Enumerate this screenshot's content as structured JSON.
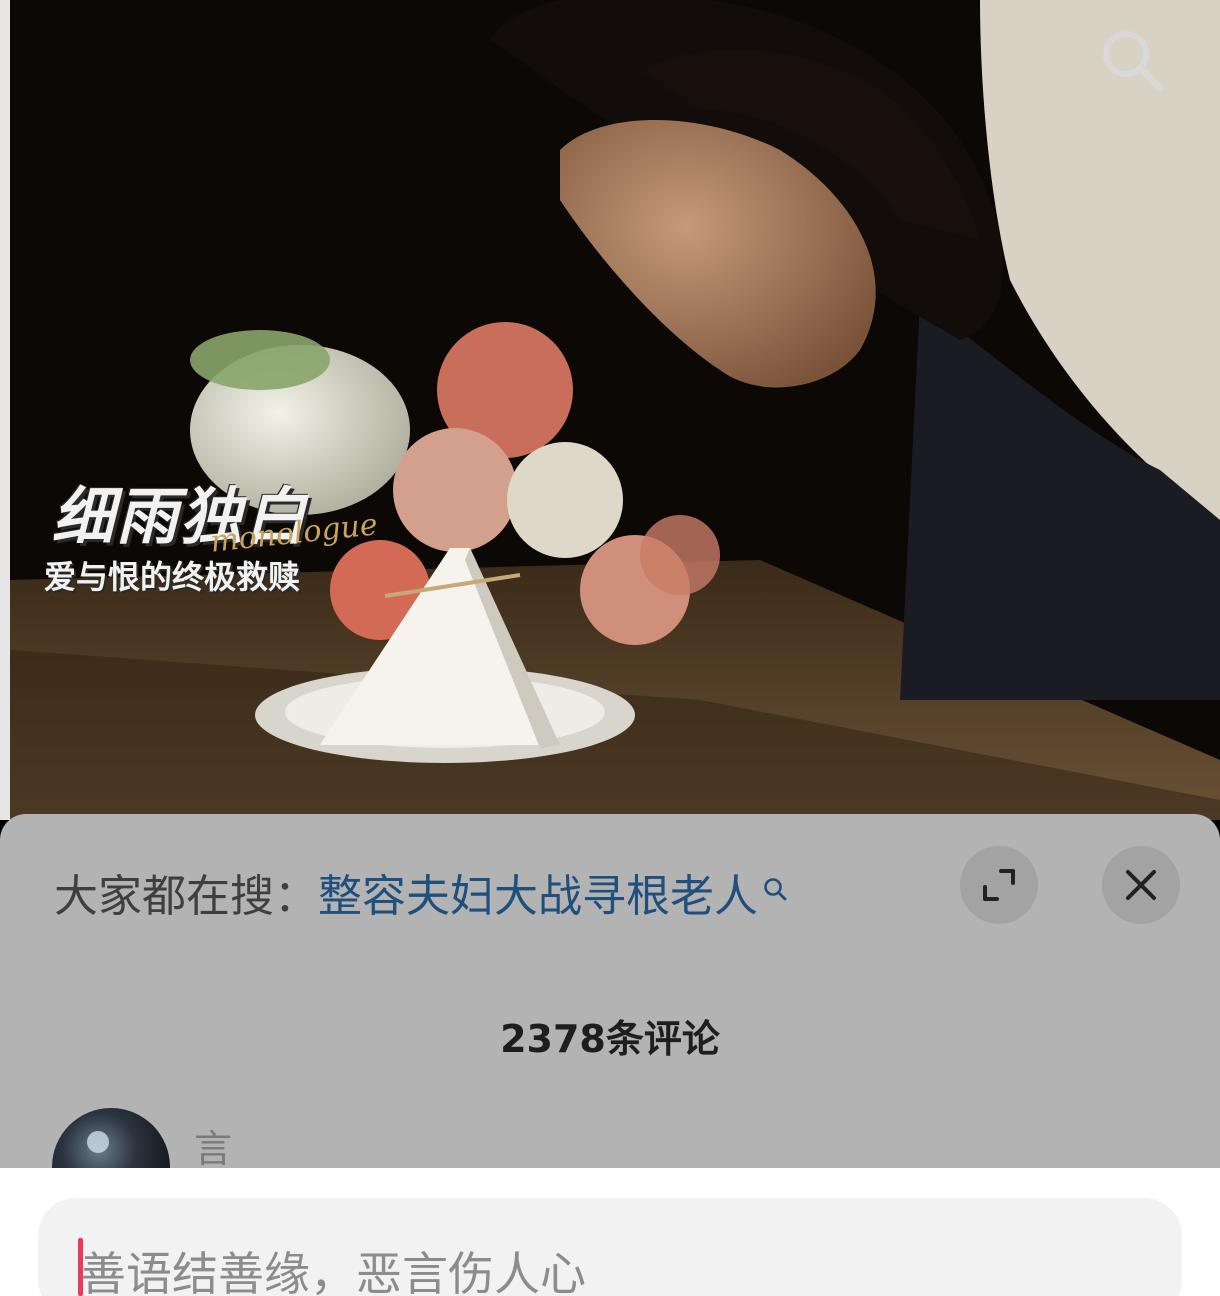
{
  "video": {
    "overlay_title": "细雨独白",
    "overlay_script": "monologue",
    "overlay_subtitle": "爱与恨的终极救赎",
    "search_icon": "search-icon"
  },
  "comments_panel": {
    "hot_search_label": "大家都在搜：",
    "hot_search_term": "整容夫妇大战寻根老人",
    "expand_icon": "expand-icon",
    "close_icon": "close-icon",
    "comment_count": "2378条评论",
    "comments": [
      {
        "author": "言"
      }
    ]
  },
  "input": {
    "placeholder": "善语结善缘，恶言伤人心"
  }
}
